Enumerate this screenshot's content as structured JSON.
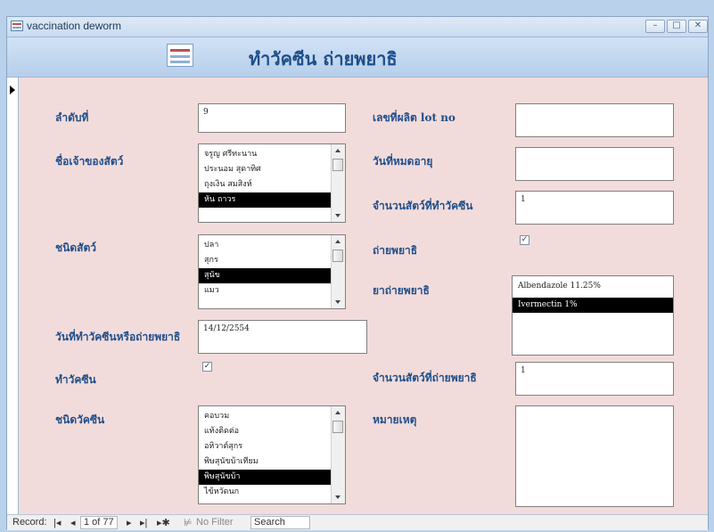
{
  "window": {
    "title": "vaccination deworm"
  },
  "form": {
    "title": "ทำวัคซีน ถ่ายพยาธิ"
  },
  "fields": {
    "seq": {
      "label": "ลำดับที่",
      "value": "9"
    },
    "owner": {
      "label": "ชื่อเจ้าของสัตว์",
      "options": [
        "จรูญ ศรีทะนาน",
        "ประนอม สุดาทิศ",
        "ถุงเงิน สมสิงห์",
        "หัน ถาวร"
      ],
      "selected": "หัน ถาวร"
    },
    "animal_type": {
      "label": "ชนิดสัตว์",
      "options": [
        "ปลา",
        "สุกร",
        "สุนัข",
        "แมว"
      ],
      "selected": "สุนัข"
    },
    "date": {
      "label": "วันที่ทำวัคซีนหรือถ่ายพยาธิ",
      "value": "14/12/2554"
    },
    "vaccinate": {
      "label": "ทำวัคซีน",
      "checked": true
    },
    "vaccine_type": {
      "label": "ชนิดวัคซีน",
      "options": [
        "คอบวม",
        "แท้งติดต่อ",
        "อหิวาต์สุกร",
        "พิษสุนัขบ้าเทียม",
        "พิษสุนัขบ้า",
        "ไข้หวัดนก"
      ],
      "selected": "พิษสุนัขบ้า"
    },
    "lot_no": {
      "label": "เลขที่ผลิต lot no",
      "value": ""
    },
    "expiry": {
      "label": "วันที่หมดอายุ",
      "value": ""
    },
    "vaccinated_count": {
      "label": "จำนวนสัตว์ที่ทำวัคซีน",
      "value": "1"
    },
    "deworm": {
      "label": "ถ่ายพยาธิ",
      "checked": true
    },
    "dewormer": {
      "label": "ยาถ่ายพยาธิ",
      "options": [
        "Albendazole 11.25%",
        "Ivermectin 1%"
      ],
      "selected": "Ivermectin 1%"
    },
    "dewormed_count": {
      "label": "จำนวนสัตว์ที่ถ่ายพยาธิ",
      "value": "1"
    },
    "note": {
      "label": "หมายเหตุ",
      "value": ""
    }
  },
  "nav": {
    "record_label": "Record:",
    "first": "|◂",
    "prev": "◂",
    "position": "1 of 77",
    "next": "▸",
    "last": "▸|",
    "new": "▸✱",
    "filter_icon": "filter-icon",
    "no_filter": "No Filter",
    "search_placeholder": "Search"
  }
}
